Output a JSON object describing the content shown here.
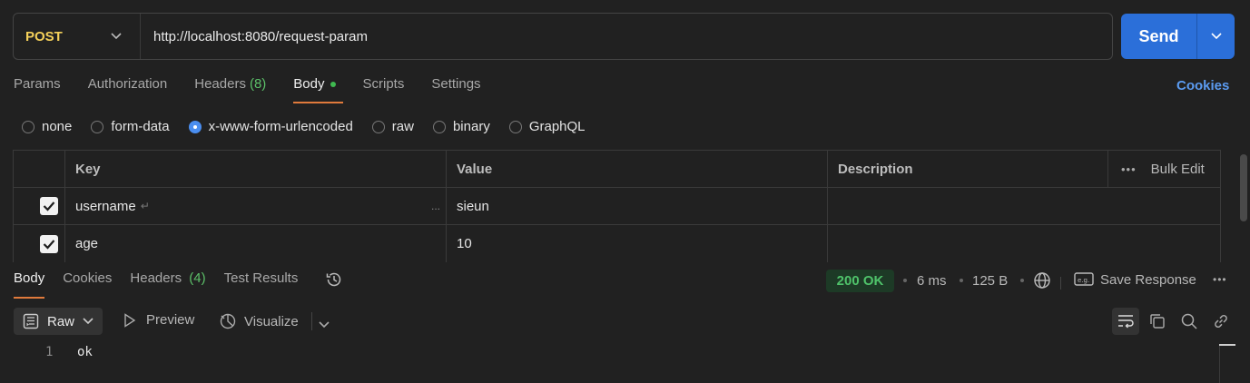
{
  "request": {
    "method": "POST",
    "url": "http://localhost:8080/request-param",
    "send_label": "Send"
  },
  "request_tabs": {
    "params": "Params",
    "authorization": "Authorization",
    "headers": "Headers",
    "headers_count": "(8)",
    "body": "Body",
    "scripts": "Scripts",
    "settings": "Settings",
    "cookies": "Cookies"
  },
  "body_types": {
    "none": "none",
    "form_data": "form-data",
    "urlencoded": "x-www-form-urlencoded",
    "raw": "raw",
    "binary": "binary",
    "graphql": "GraphQL",
    "selected": "x-www-form-urlencoded"
  },
  "params_table": {
    "headers": {
      "key": "Key",
      "value": "Value",
      "description": "Description",
      "bulk_edit": "Bulk Edit"
    },
    "rows": [
      {
        "checked": true,
        "key": "username",
        "value": "sieun",
        "description": ""
      },
      {
        "checked": true,
        "key": "age",
        "value": "10",
        "description": ""
      }
    ]
  },
  "response_tabs": {
    "body": "Body",
    "cookies": "Cookies",
    "headers": "Headers",
    "headers_count": "(4)",
    "test_results": "Test Results"
  },
  "response_meta": {
    "status": "200 OK",
    "time": "6 ms",
    "size": "125 B",
    "save_response": "Save Response"
  },
  "response_toolbar": {
    "format": "Raw",
    "preview": "Preview",
    "visualize": "Visualize"
  },
  "response_body": {
    "line_number": "1",
    "content": "ok"
  },
  "colors": {
    "method": "#f5d15a",
    "send": "#2b6fd9",
    "active_tab_underline": "#e07a3c",
    "status_ok": "#4fc26a",
    "cookies_link": "#5b9bf0"
  }
}
